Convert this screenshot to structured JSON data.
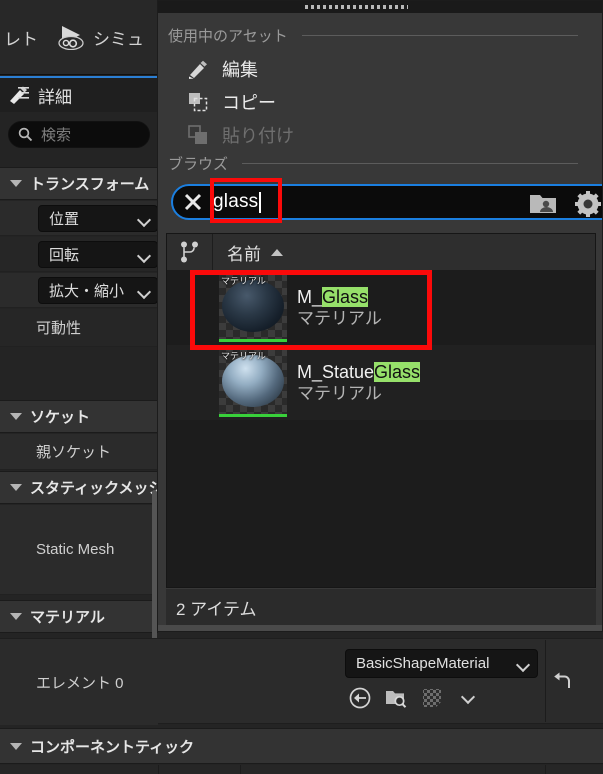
{
  "app": {
    "toolbar": {
      "left_tab_text": "レト",
      "simulate_label": "シミュ",
      "play_icon": "play-gear-icon"
    },
    "details_tab": {
      "title": "詳細",
      "icon": "details-pencil-icon"
    },
    "details_search": {
      "placeholder": "検索",
      "value": "",
      "icon": "search-icon"
    }
  },
  "details": {
    "sections": [
      {
        "label": "トランスフォーム",
        "expanded": true
      },
      {
        "label": "ソケット",
        "expanded": true
      },
      {
        "label": "スタティックメッシ",
        "expanded": true
      },
      {
        "label": "マテリアル",
        "expanded": true
      },
      {
        "label": "コンポーネントティック",
        "expanded": true
      }
    ],
    "transform_rows": [
      {
        "combo": "位置"
      },
      {
        "combo": "回転"
      },
      {
        "combo": "拡大・縮小"
      }
    ],
    "mobility_label": "可動性",
    "parent_socket_label": "親ソケット",
    "static_mesh_label": "Static Mesh",
    "element_label": "エレメント 0"
  },
  "material_widget": {
    "asset_name": "BasicShapeMaterial",
    "dropdown_icon": "chevron-down-icon",
    "thumbnail": "white-sphere-material-thumbnail",
    "icons": [
      {
        "name": "browse-to-asset-icon"
      },
      {
        "name": "find-in-content-browser-icon"
      },
      {
        "name": "use-selected-asset-icon"
      },
      {
        "name": "chevron-down-icon"
      }
    ],
    "reset_icon": "reset-to-default-arrow-icon"
  },
  "popup": {
    "drag_handle": "drag-dots-handle",
    "sections": [
      {
        "id": "used_asset",
        "title": "使用中のアセット"
      },
      {
        "id": "browse",
        "title": "ブラウズ"
      }
    ],
    "menu_items": [
      {
        "label": "編集",
        "icon": "pencil-edit-icon",
        "enabled": true
      },
      {
        "label": "コピー",
        "icon": "copy-icon",
        "enabled": true
      },
      {
        "label": "貼り付け",
        "icon": "paste-icon",
        "enabled": false
      }
    ],
    "search": {
      "value": "glass",
      "clear_icon": "clear-x-icon",
      "folder_icon": "show-source-folder-icon",
      "settings_icon": "settings-gear-icon"
    },
    "list": {
      "header": {
        "tree_icon": "hierarchy-tree-icon",
        "name_column": "名前",
        "sort": "ascending"
      },
      "rows": [
        {
          "name_prefix": "M_",
          "name_match": "Glass",
          "name_suffix": "",
          "type": "マテリアル",
          "thumb_tag": "マテリアル",
          "selected": true
        },
        {
          "name_prefix": "M_Statue",
          "name_match": "Glass",
          "name_suffix": "",
          "type": "マテリアル",
          "thumb_tag": "マテリアル",
          "selected": false
        }
      ],
      "count_label": "2 アイテム"
    }
  },
  "colors": {
    "highlight_box": "#fb0a0a",
    "match_highlight": "#96e06a",
    "focus_ring": "#1b7fe0",
    "tab_accent": "#2b7fd4",
    "asset_state_bar": "#39d03b"
  }
}
